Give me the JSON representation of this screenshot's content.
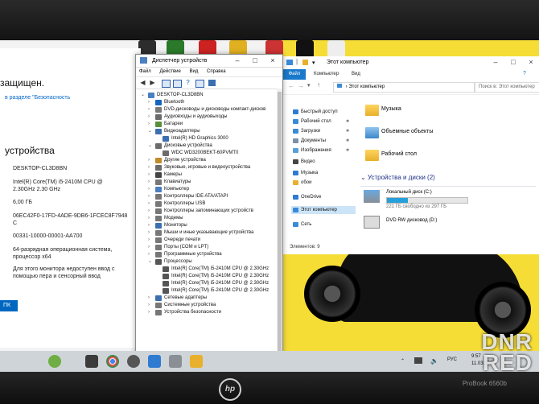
{
  "sysprops": {
    "heading_partial": "защищен.",
    "link_partial": "в разделе \"Безопасность",
    "section_title": "устройства",
    "device_name": "DESKTOP-CL3D8BN",
    "cpu_line1": "Intel(R) Core(TM) i5-2410M CPU @",
    "cpu_line2": "2.30GHz   2.30 GHz",
    "ram": "6,00 ГБ",
    "device_id_line1": "06EC42F0-17FD-4ADE-9DB6-1FCEC8F7948",
    "device_id_line2": "C",
    "product_id": "00331-10000-00001-AA700",
    "system_type_line1": "64-разрядная операционная система,",
    "system_type_line2": "процессор x64",
    "pen_line1": "Для этого монитора недоступен ввод с",
    "pen_line2": "помощью пера и сенсорный ввод",
    "button_partial": "ПК"
  },
  "devmgr": {
    "title": "Диспетчер устройств",
    "menu": [
      "Файл",
      "Действие",
      "Вид",
      "Справка"
    ],
    "tree": [
      {
        "label": "DESKTOP-CL3D8BN",
        "level": 0,
        "arrow": "down",
        "icon": "computer-icon",
        "color": "#4a7fc1"
      },
      {
        "label": "Bluetooth",
        "level": 1,
        "arrow": "right",
        "icon": "bluetooth-icon",
        "color": "#1565c0"
      },
      {
        "label": "DVD-дисководы и дисководы компакт-дисков",
        "level": 1,
        "arrow": "right",
        "icon": "dvd-drive-icon",
        "color": "#7a7a7a"
      },
      {
        "label": "Аудиовходы и аудиовыходы",
        "level": 1,
        "arrow": "right",
        "icon": "audio-icon",
        "color": "#6b6b6b"
      },
      {
        "label": "Батареи",
        "level": 1,
        "arrow": "right",
        "icon": "battery-icon",
        "color": "#5a8f3a"
      },
      {
        "label": "Видеоадаптеры",
        "level": 1,
        "arrow": "down",
        "icon": "display-adapter-icon",
        "color": "#3b6fb0"
      },
      {
        "label": "Intel(R) HD Graphics 3000",
        "level": 2,
        "arrow": "",
        "icon": "display-adapter-icon",
        "color": "#3b6fb0"
      },
      {
        "label": "Дисковые устройства",
        "level": 1,
        "arrow": "down",
        "icon": "disk-icon",
        "color": "#6b6b6b"
      },
      {
        "label": "WDC WD3200BEKT-60PVMT0",
        "level": 2,
        "arrow": "",
        "icon": "disk-icon",
        "color": "#6b6b6b"
      },
      {
        "label": "Другие устройства",
        "level": 1,
        "arrow": "right",
        "icon": "other-device-icon",
        "color": "#c28b2a"
      },
      {
        "label": "Звуковые, игровые и видеоустройства",
        "level": 1,
        "arrow": "right",
        "icon": "sound-icon",
        "color": "#6b6b6b"
      },
      {
        "label": "Камеры",
        "level": 1,
        "arrow": "right",
        "icon": "camera-icon",
        "color": "#444"
      },
      {
        "label": "Клавиатуры",
        "level": 1,
        "arrow": "right",
        "icon": "keyboard-icon",
        "color": "#777"
      },
      {
        "label": "Компьютер",
        "level": 1,
        "arrow": "right",
        "icon": "computer-icon",
        "color": "#4a7fc1"
      },
      {
        "label": "Контроллеры IDE ATA/ATAPI",
        "level": 1,
        "arrow": "right",
        "icon": "controller-icon",
        "color": "#777"
      },
      {
        "label": "Контроллеры USB",
        "level": 1,
        "arrow": "right",
        "icon": "usb-icon",
        "color": "#777"
      },
      {
        "label": "Контроллеры запоминающих устройств",
        "level": 1,
        "arrow": "right",
        "icon": "storage-controller-icon",
        "color": "#777"
      },
      {
        "label": "Модемы",
        "level": 1,
        "arrow": "right",
        "icon": "modem-icon",
        "color": "#777"
      },
      {
        "label": "Мониторы",
        "level": 1,
        "arrow": "right",
        "icon": "monitor-icon",
        "color": "#3b6fb0"
      },
      {
        "label": "Мыши и иные указывающие устройства",
        "level": 1,
        "arrow": "right",
        "icon": "mouse-icon",
        "color": "#777"
      },
      {
        "label": "Очереди печати",
        "level": 1,
        "arrow": "right",
        "icon": "printer-icon",
        "color": "#777"
      },
      {
        "label": "Порты (COM и LPT)",
        "level": 1,
        "arrow": "right",
        "icon": "port-icon",
        "color": "#777"
      },
      {
        "label": "Программные устройства",
        "level": 1,
        "arrow": "right",
        "icon": "software-device-icon",
        "color": "#777"
      },
      {
        "label": "Процессоры",
        "level": 1,
        "arrow": "down",
        "icon": "processor-icon",
        "color": "#555"
      },
      {
        "label": "Intel(R) Core(TM) i5-2410M CPU @ 2.30GHz",
        "level": 2,
        "arrow": "",
        "icon": "processor-icon",
        "color": "#555"
      },
      {
        "label": "Intel(R) Core(TM) i5-2410M CPU @ 2.30GHz",
        "level": 2,
        "arrow": "",
        "icon": "processor-icon",
        "color": "#555"
      },
      {
        "label": "Intel(R) Core(TM) i5-2410M CPU @ 2.30GHz",
        "level": 2,
        "arrow": "",
        "icon": "processor-icon",
        "color": "#555"
      },
      {
        "label": "Intel(R) Core(TM) i5-2410M CPU @ 2.30GHz",
        "level": 2,
        "arrow": "",
        "icon": "processor-icon",
        "color": "#555"
      },
      {
        "label": "Сетевые адаптеры",
        "level": 1,
        "arrow": "right",
        "icon": "network-adapter-icon",
        "color": "#3b6fb0"
      },
      {
        "label": "Системные устройства",
        "level": 1,
        "arrow": "right",
        "icon": "system-device-icon",
        "color": "#777"
      },
      {
        "label": "Устройства безопасности",
        "level": 1,
        "arrow": "right",
        "icon": "security-device-icon",
        "color": "#777"
      }
    ]
  },
  "explorer": {
    "title": "Этот компьютер",
    "ribbon_tabs": [
      "Файл",
      "Компьютер",
      "Вид"
    ],
    "address": "Этот компьютер",
    "search_placeholder": "Поиск в: Этот компьютер",
    "nav": [
      {
        "label": "Быстрый доступ",
        "icon": "star-icon",
        "color": "#2f7bd1",
        "pinned": false
      },
      {
        "label": "Рабочий стол",
        "icon": "desktop-icon",
        "color": "#3b8ad8",
        "pinned": true
      },
      {
        "label": "Загрузки",
        "icon": "download-icon",
        "color": "#3b8ad8",
        "pinned": true
      },
      {
        "label": "Документы",
        "icon": "documents-icon",
        "color": "#7a8fa8",
        "pinned": true
      },
      {
        "label": "Изображения",
        "icon": "pictures-icon",
        "color": "#5aa0d8",
        "pinned": true
      },
      {
        "label": "Видео",
        "icon": "video-icon",
        "color": "#444",
        "pinned": false
      },
      {
        "label": "Музыка",
        "icon": "music-icon",
        "color": "#2f7bd1",
        "pinned": false
      },
      {
        "label": "обои",
        "icon": "folder-icon",
        "color": "#e8b02c",
        "pinned": false
      },
      {
        "label": "OneDrive",
        "icon": "onedrive-icon",
        "color": "#2f7bd1",
        "pinned": false
      },
      {
        "label": "Этот компьютер",
        "icon": "this-pc-icon",
        "color": "#3b8ad8",
        "pinned": false
      },
      {
        "label": "Сеть",
        "icon": "network-icon",
        "color": "#3b8ad8",
        "pinned": false
      }
    ],
    "folders": [
      "Музыка",
      "Объемные объекты",
      "Рабочий стол"
    ],
    "drives_section": "Устройства и диски (2)",
    "drives": [
      {
        "name": "Локальный диск (C:)",
        "free": "221 ГБ свободно из 297 ГБ",
        "used_fraction": 0.26
      },
      {
        "name": "DVD RW дисковод (D:)",
        "free": "",
        "used_fraction": null
      }
    ],
    "status": "Элементов: 9"
  },
  "taskbar": {
    "time": "9:57",
    "date": "11.03.2025"
  },
  "laptop": {
    "brand": "hp",
    "model": "ProBook 6560b"
  },
  "watermark": {
    "line1": "DNR",
    "line2": "RED"
  }
}
